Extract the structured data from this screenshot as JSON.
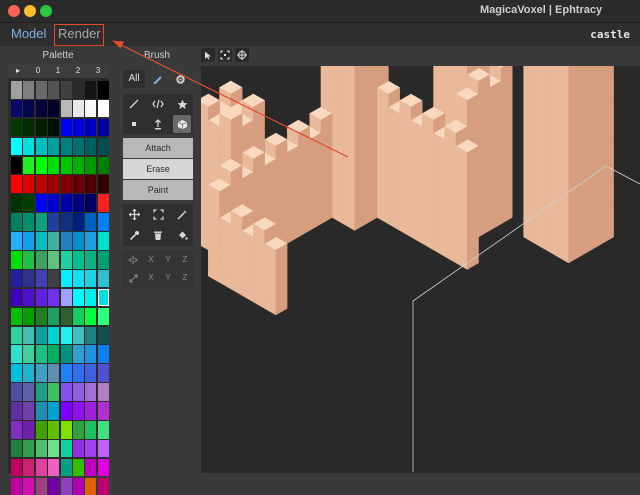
{
  "window": {
    "title": "MagicaVoxel | Ephtracy"
  },
  "topbar": {
    "model_label": "Model",
    "render_label": "Render",
    "filename": "castle"
  },
  "palette": {
    "title": "Palette",
    "headers": [
      "▸",
      "0",
      "1",
      "2",
      "3"
    ],
    "selected_index": 95,
    "colors": [
      "#a0a0a0",
      "#808080",
      "#6a6a6a",
      "#545454",
      "#404040",
      "#2a2a2a",
      "#141414",
      "#000000",
      "#080866",
      "#060650",
      "#04043a",
      "#020226",
      "#b8b8b8",
      "#e8e8e8",
      "#f8f8f8",
      "#ffffff",
      "#003a00",
      "#002c00",
      "#001e00",
      "#001000",
      "#0000ff",
      "#0000e0",
      "#0000c0",
      "#0000a0",
      "#00ffff",
      "#00e0e0",
      "#00c0c0",
      "#00a0a0",
      "#008080",
      "#007070",
      "#006060",
      "#005050",
      "#000000",
      "#20f020",
      "#00ff00",
      "#00e000",
      "#00c800",
      "#00b000",
      "#009800",
      "#008000",
      "#ff0000",
      "#e00000",
      "#c00000",
      "#a00000",
      "#800000",
      "#660000",
      "#4c0000",
      "#330000",
      "#003300",
      "#004000",
      "#0000ff",
      "#0000d0",
      "#0000a8",
      "#000080",
      "#000060",
      "#ff2020",
      "#008060",
      "#009070",
      "#10a080",
      "#2040a0",
      "#103080",
      "#002080",
      "#0060c0",
      "#0080ff",
      "#20b0ff",
      "#10a0f0",
      "#00c0c0",
      "#40b0a0",
      "#2080c0",
      "#0090d0",
      "#20a0e0",
      "#00e0d0",
      "#00e000",
      "#20c040",
      "#40a060",
      "#60c080",
      "#20d0a0",
      "#00c090",
      "#10b080",
      "#00a070",
      "#2020a0",
      "#303090",
      "#4040b0",
      "#404040",
      "#00f0ff",
      "#10e0f0",
      "#20d0e0",
      "#30c0d0",
      "#4000c0",
      "#5010d0",
      "#6020e0",
      "#7030f0",
      "#a0a0ff",
      "#00ffff",
      "#00f0f0",
      "#00e0e0",
      "#00c000",
      "#00a000",
      "#208020",
      "#20a060",
      "#306030",
      "#10d060",
      "#00ff40",
      "#30ff80",
      "#30d0a0",
      "#40c0b0",
      "#10a0a0",
      "#00d0d0",
      "#20f0f0",
      "#40c0c0",
      "#208080",
      "#105050",
      "#30e0d0",
      "#40d0a0",
      "#20c080",
      "#00b060",
      "#009080",
      "#30a0d0",
      "#2090e0",
      "#1080f0",
      "#00c0e0",
      "#20b0d0",
      "#40a0c0",
      "#6090b0",
      "#2080ff",
      "#3070f0",
      "#4060e0",
      "#5050d0",
      "#5050a0",
      "#6060b0",
      "#20a080",
      "#40c060",
      "#8050f0",
      "#9060e0",
      "#a070d0",
      "#b080c0",
      "#6030a0",
      "#7040b0",
      "#2090b0",
      "#00a0d0",
      "#8000ff",
      "#9010f0",
      "#a020e0",
      "#b030d0",
      "#8030c0",
      "#7020b0",
      "#40a000",
      "#60c000",
      "#80e000",
      "#30a040",
      "#20c060",
      "#40e080",
      "#208040",
      "#30a050",
      "#50c070",
      "#70e090",
      "#10d0a0",
      "#9030e0",
      "#a040f0",
      "#c060ff",
      "#c00060",
      "#d02070",
      "#e040a0",
      "#f060c0",
      "#00a080",
      "#30c000",
      "#c000c0",
      "#e000e0",
      "#c000a0",
      "#d010b0",
      "#a04080",
      "#7000a0",
      "#9040c0",
      "#b000b0",
      "#e06000",
      "#c00070"
    ]
  },
  "brush": {
    "title": "Brush",
    "all_label": "All",
    "attach_label": "Attach",
    "erase_label": "Erase",
    "paint_label": "Paint",
    "axis_labels": [
      "X",
      "Y",
      "Z"
    ]
  },
  "colors": {
    "accent_blue": "#7fb0e8",
    "annotation_red": "#e24b2c",
    "voxel_top": "#f8d8bf",
    "voxel_left": "#e9b99a",
    "voxel_right": "#d69e7e"
  }
}
